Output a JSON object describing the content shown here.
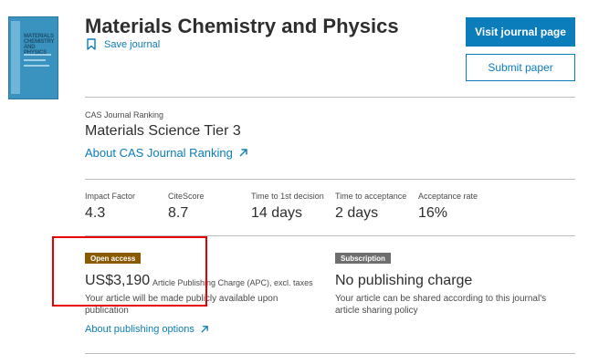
{
  "journal": {
    "title": "Materials Chemistry and Physics",
    "save_label": "Save journal",
    "cover_text": "MATERIALS CHEMISTRY AND PHYSICS"
  },
  "actions": {
    "visit_label": "Visit journal page",
    "submit_label": "Submit paper"
  },
  "cas": {
    "label": "CAS Journal Ranking",
    "value": "Materials Science Tier 3",
    "link_label": "About CAS Journal Ranking"
  },
  "metrics": [
    {
      "label": "Impact Factor",
      "value": "4.3"
    },
    {
      "label": "CiteScore",
      "value": "8.7"
    },
    {
      "label": "Time to 1st decision",
      "value": "14 days"
    },
    {
      "label": "Time to acceptance",
      "value": "2 days"
    },
    {
      "label": "Acceptance rate",
      "value": "16%"
    }
  ],
  "open_access": {
    "badge": "Open access",
    "price": "US$3,190",
    "price_note": "Article Publishing Charge (APC), excl. taxes",
    "description": "Your article will be made publicly available upon publication",
    "link_label": "About publishing options"
  },
  "subscription": {
    "badge": "Subscription",
    "title": "No publishing charge",
    "description": "Your article can be shared according to this journal's article sharing policy"
  },
  "colors": {
    "accent": "#0c7dbb",
    "open_access_badge": "#8a5a00",
    "subscription_badge": "#6e6e6e",
    "highlight": "#e60000"
  }
}
